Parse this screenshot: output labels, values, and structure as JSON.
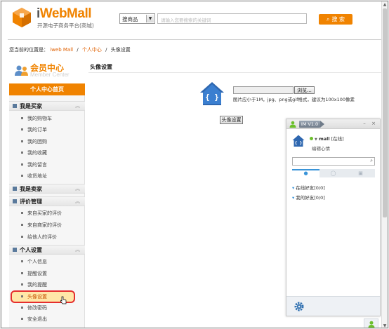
{
  "header": {
    "brand": "iWebMall",
    "brand_i": "i",
    "brand_rest": "WebMall",
    "tagline": "开源电子商务平台(商城)",
    "search_select": "搜商品",
    "search_placeholder": "请输入您要搜索的关键词",
    "search_button": "搜 索"
  },
  "breadcrumb": {
    "prefix": "您当前的位置是：",
    "items": [
      "iweb Mall",
      "个人中心",
      "头像设置"
    ],
    "sep": "/"
  },
  "sidebar": {
    "title": "会员中心",
    "subtitle": "Member Center",
    "home_button": "个人中心首页",
    "sections": [
      {
        "label": "我是买家",
        "items": [
          "我的购物车",
          "我的订单",
          "我的团购",
          "我的收藏",
          "我的留言",
          "收货地址"
        ]
      },
      {
        "label": "我是卖家",
        "items": []
      },
      {
        "label": "评价管理",
        "items": [
          "来自买家的评价",
          "来自商家的评价",
          "给他人的评价"
        ]
      },
      {
        "label": "个人设置",
        "items": [
          "个人信息",
          "提醒设置",
          "我的提醒",
          "头像设置",
          "修改密码",
          "安全退出"
        ]
      }
    ],
    "active_item": "头像设置"
  },
  "main": {
    "title": "头像设置",
    "browse_button": "浏览...",
    "hint": "图片应小于1M，jpg、png或gif格式，建议为100x100像素",
    "submit_button": "头像设置"
  },
  "im": {
    "version": "IM V1.0",
    "nickname": "mall",
    "status": "[在线]",
    "signature": "编辑心情",
    "groups": [
      "在线好友[0/0]",
      "我的好友[0/0]"
    ]
  },
  "colors": {
    "accent": "#f08300",
    "im_blue": "#3a94d8",
    "active_border": "#e52e2e"
  }
}
